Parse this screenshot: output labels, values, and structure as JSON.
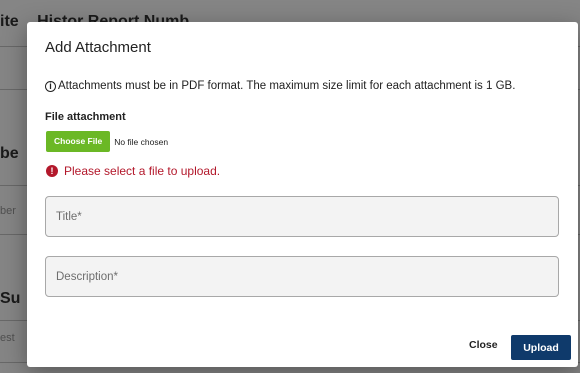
{
  "background": {
    "heading_top": "ite",
    "heading_top_cut": "Histor  Report Numb",
    "heading_mid": "be",
    "placeholder_mid": "ber",
    "heading_lower": "Su",
    "placeholder_lower": "est"
  },
  "modal": {
    "title": "Add Attachment",
    "info_icon_glyph": "i",
    "info_text": "Attachments must be in PDF format. The maximum size limit for each attachment is 1 GB.",
    "file_label": "File attachment",
    "choose_button": "Choose File",
    "file_status": "No file chosen",
    "error_icon_glyph": "!",
    "error_text": "Please select a file to upload.",
    "title_placeholder": "Title*",
    "description_placeholder": "Description*",
    "close_button": "Close",
    "upload_button": "Upload"
  },
  "colors": {
    "choose_button": "#6bb825",
    "error": "#b3182b",
    "upload_button": "#0f3a6b"
  }
}
